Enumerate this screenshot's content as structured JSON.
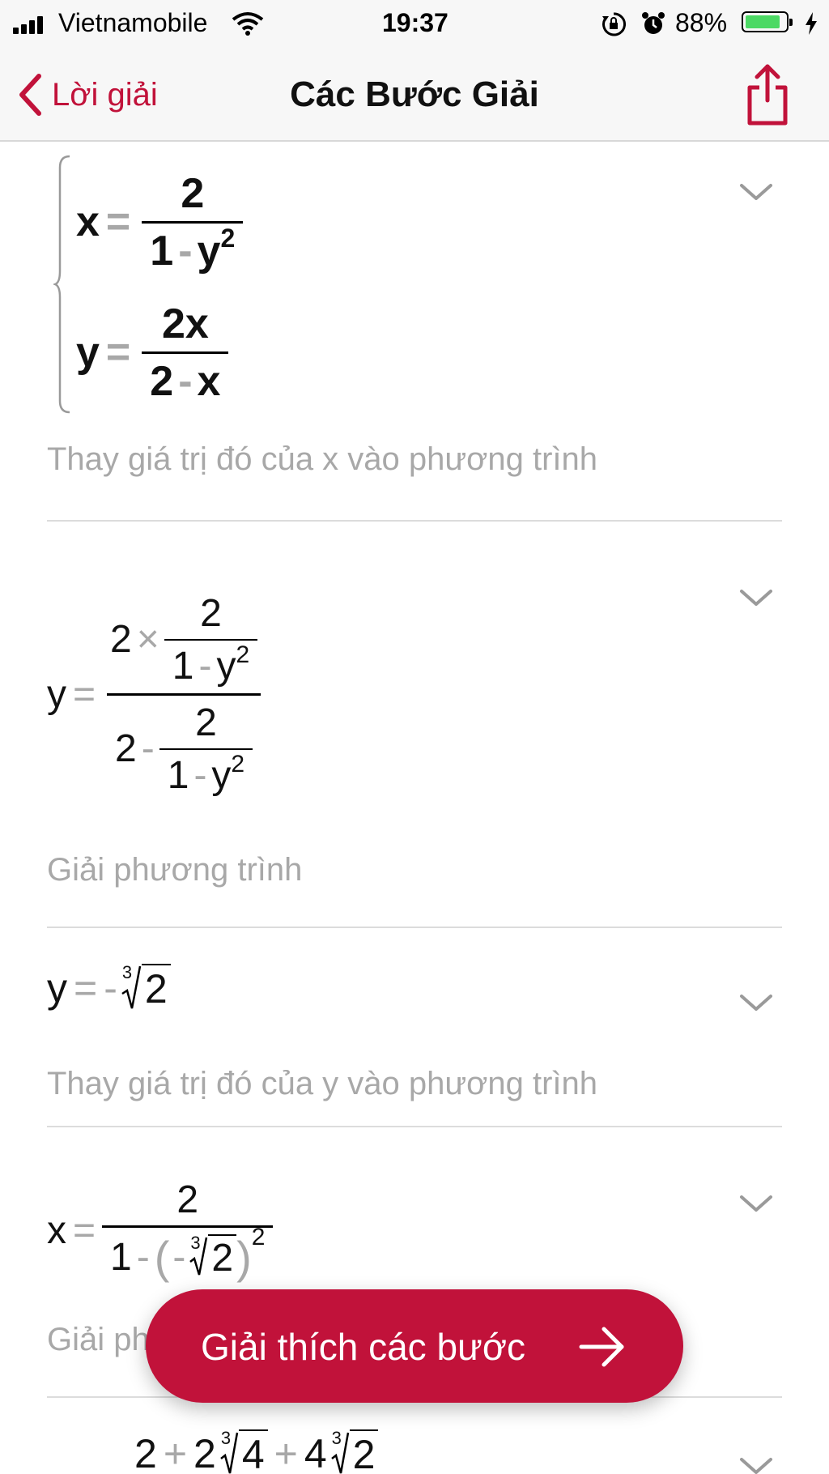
{
  "status_bar": {
    "carrier": "Vietnamobile",
    "time": "19:37",
    "battery": "88%",
    "battery_level": 0.88,
    "icons": [
      "signal-icon",
      "wifi-icon",
      "rotation-lock-icon",
      "alarm-icon",
      "battery-icon",
      "charging-icon"
    ]
  },
  "nav": {
    "back_label": "Lời giải",
    "title": "Các Bước Giải",
    "share_icon": "share-icon",
    "accent": "#c1123a"
  },
  "steps": [
    {
      "formula": {
        "eq1_lhs": "x",
        "eq1_op": "=",
        "eq1_num": "2",
        "eq1_den_a": "1",
        "eq1_den_op": "-",
        "eq1_den_b": "y",
        "eq1_den_exp": "2",
        "eq2_lhs": "y",
        "eq2_op": "=",
        "eq2_num": "2x",
        "eq2_den_a": "2",
        "eq2_den_op": "-",
        "eq2_den_b": "x"
      },
      "description": "Thay giá trị đó của x vào phương trình"
    },
    {
      "formula": {
        "lhs": "y",
        "op": "=",
        "n_coef": "2",
        "n_times": "×",
        "n_num": "2",
        "n_den_a": "1",
        "n_den_op": "-",
        "n_den_b": "y",
        "n_den_exp": "2",
        "d_coef": "2",
        "d_minus": "-",
        "d_num": "2",
        "d_den_a": "1",
        "d_den_op": "-",
        "d_den_b": "y",
        "d_den_exp": "2"
      },
      "description": "Giải phương trình"
    },
    {
      "formula": {
        "lhs": "y",
        "op": "=",
        "sign": "-",
        "index": "3",
        "radicand": "2"
      },
      "description": "Thay giá trị đó của y vào phương trình"
    },
    {
      "formula": {
        "lhs": "x",
        "op": "=",
        "num": "2",
        "den_a": "1",
        "den_op": "-",
        "paren_sign": "-",
        "index": "3",
        "radicand": "2",
        "exp": "2"
      },
      "description": "Giải ph"
    },
    {
      "formula": {
        "t1": "2",
        "op1": "+",
        "t2": "2",
        "idx2": "3",
        "rad2": "4",
        "op2": "+",
        "t3": "4",
        "idx3": "3",
        "rad3": "2"
      }
    }
  ],
  "cta": {
    "label": "Giải thích các bước",
    "icon": "arrow-right-icon"
  }
}
